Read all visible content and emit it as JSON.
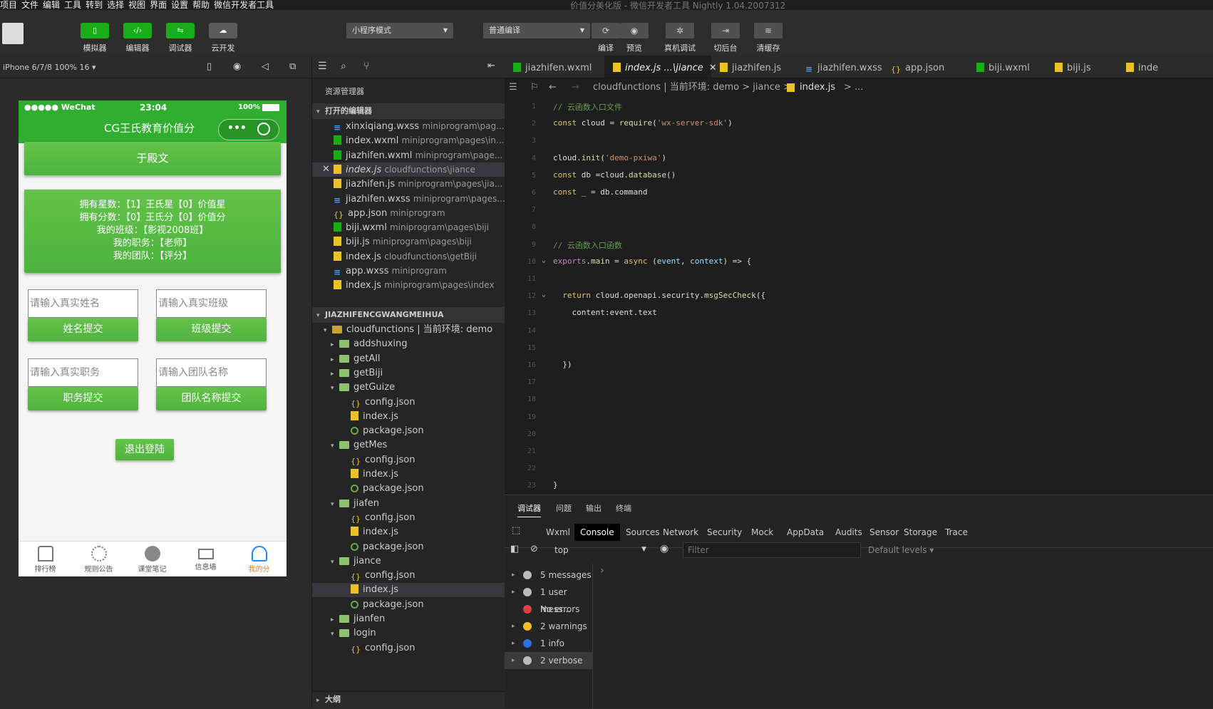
{
  "menubar": {
    "items": [
      "项目",
      "文件",
      "编辑",
      "工具",
      "转到",
      "选择",
      "视图",
      "界面",
      "设置",
      "帮助",
      "微信开发者工具"
    ],
    "window_title": "价值分美化版 - 微信开发者工具 Nightly 1.04.2007312"
  },
  "toolbar": {
    "simulator": "模拟器",
    "editor": "编辑器",
    "debugger": "调试器",
    "cloud": "云开发",
    "mode_select": "小程序模式",
    "compile_select": "普通编译",
    "compile": "编译",
    "preview": "预览",
    "real_debug": "真机调试",
    "background": "切后台",
    "clear_cache": "清缓存"
  },
  "simulator": {
    "device": "iPhone 6/7/8 100% 16 ▾",
    "status_left": "●●●●● WeChat",
    "status_time": "23:04",
    "status_battery": "100%",
    "nav_title": "CG王氏教育价值分",
    "user_name": "于殿文",
    "info_lines": [
      "拥有星数：【1】王氏星【0】价值星",
      "拥有分数：【0】王氏分【0】价值分",
      "我的班级：【影视2008班】",
      "我的职务：【老师】",
      "我的团队：【评分】"
    ],
    "name_placeholder": "请输入真实姓名",
    "class_placeholder": "请输入真实班级",
    "name_submit": "姓名提交",
    "class_submit": "班级提交",
    "duty_placeholder": "请输入真实职务",
    "team_placeholder": "请输入团队名称",
    "duty_submit": "职务提交",
    "team_submit": "团队名称提交",
    "logout": "退出登陆",
    "tabs": [
      "排行榜",
      "规则公告",
      "课堂笔记",
      "信息墙",
      "我的分"
    ],
    "active_tab_color": "#1a8cff"
  },
  "explorer": {
    "header": "资源管理器",
    "open_editors_title": "打开的编辑器",
    "open_editors": [
      {
        "name": "xinxiqiang.wxss",
        "path": "miniprogram\\pag...",
        "type": "css"
      },
      {
        "name": "index.wxml",
        "path": "miniprogram\\pages\\in...",
        "type": "wxml"
      },
      {
        "name": "jiazhifen.wxml",
        "path": "miniprogram\\page...",
        "type": "wxml"
      },
      {
        "name": "index.js",
        "path": "cloudfunctions\\jiance",
        "type": "js"
      },
      {
        "name": "jiazhifen.js",
        "path": "miniprogram\\pages\\jia...",
        "type": "js"
      },
      {
        "name": "jiazhifen.wxss",
        "path": "miniprogram\\pages...",
        "type": "css"
      },
      {
        "name": "app.json",
        "path": "miniprogram",
        "type": "json"
      },
      {
        "name": "biji.wxml",
        "path": "miniprogram\\pages\\biji",
        "type": "wxml"
      },
      {
        "name": "biji.js",
        "path": "miniprogram\\pages\\biji",
        "type": "js"
      },
      {
        "name": "index.js",
        "path": "cloudfunctions\\getBiji",
        "type": "js"
      },
      {
        "name": "app.wxss",
        "path": "miniprogram",
        "type": "css"
      },
      {
        "name": "index.js",
        "path": "miniprogram\\pages\\index",
        "type": "js"
      }
    ],
    "project_title": "JIAZHIFENCGWANGMEIHUA",
    "tree": [
      {
        "name": "cloudfunctions | 当前环境: demo",
        "type": "opendir",
        "indent": 1,
        "caret": "▾"
      },
      {
        "name": "addshuxing",
        "type": "dir",
        "indent": 2,
        "caret": "▸"
      },
      {
        "name": "getAll",
        "type": "dir",
        "indent": 2,
        "caret": "▸"
      },
      {
        "name": "getBiji",
        "type": "dir",
        "indent": 2,
        "caret": "▸"
      },
      {
        "name": "getGuize",
        "type": "dir",
        "indent": 2,
        "caret": "▾"
      },
      {
        "name": "config.json",
        "type": "json",
        "indent": 3,
        "caret": ""
      },
      {
        "name": "index.js",
        "type": "js",
        "indent": 3,
        "caret": ""
      },
      {
        "name": "package.json",
        "type": "pkg",
        "indent": 3,
        "caret": ""
      },
      {
        "name": "getMes",
        "type": "dir",
        "indent": 2,
        "caret": "▾"
      },
      {
        "name": "config.json",
        "type": "json",
        "indent": 3,
        "caret": ""
      },
      {
        "name": "index.js",
        "type": "js",
        "indent": 3,
        "caret": ""
      },
      {
        "name": "package.json",
        "type": "pkg",
        "indent": 3,
        "caret": ""
      },
      {
        "name": "jiafen",
        "type": "dir",
        "indent": 2,
        "caret": "▾"
      },
      {
        "name": "config.json",
        "type": "json",
        "indent": 3,
        "caret": ""
      },
      {
        "name": "index.js",
        "type": "js",
        "indent": 3,
        "caret": ""
      },
      {
        "name": "package.json",
        "type": "pkg",
        "indent": 3,
        "caret": ""
      },
      {
        "name": "jiance",
        "type": "dir",
        "indent": 2,
        "caret": "▾"
      },
      {
        "name": "config.json",
        "type": "json",
        "indent": 3,
        "caret": ""
      },
      {
        "name": "index.js",
        "type": "js",
        "indent": 3,
        "caret": "",
        "selected": true
      },
      {
        "name": "package.json",
        "type": "pkg",
        "indent": 3,
        "caret": ""
      },
      {
        "name": "jianfen",
        "type": "dir",
        "indent": 2,
        "caret": "▸"
      },
      {
        "name": "login",
        "type": "dir",
        "indent": 2,
        "caret": "▾"
      },
      {
        "name": "config.json",
        "type": "json",
        "indent": 3,
        "caret": ""
      }
    ],
    "outline_title": "大纲"
  },
  "editor_tabs": [
    {
      "name": "jiazhifen.wxml",
      "type": "wxml"
    },
    {
      "name": "index.js ...\\jiance",
      "type": "js",
      "active": true
    },
    {
      "name": "jiazhifen.js",
      "type": "js"
    },
    {
      "name": "jiazhifen.wxss",
      "type": "css"
    },
    {
      "name": "app.json",
      "type": "json"
    },
    {
      "name": "biji.wxml",
      "type": "wxml"
    },
    {
      "name": "biji.js",
      "type": "js"
    },
    {
      "name": "inde",
      "type": "js"
    }
  ],
  "breadcrumb": {
    "path": "cloudfunctions | 当前环境: demo  >  jiance  >",
    "file": "index.js",
    "more": "> ..."
  },
  "code_lines": [
    "// 云函数入口文件",
    "const cloud = require('wx-server-sdk')",
    "",
    "cloud.init('demo-pxiwa')",
    "const db =cloud.database()",
    "const _ = db.command",
    "",
    "",
    "// 云函数入口函数",
    "exports.main = async (event, context) => {",
    "",
    "  return cloud.openapi.security.msgSecCheck({",
    "    content:event.text",
    "",
    "",
    "  })",
    "",
    "",
    "",
    "",
    "",
    "",
    "}"
  ],
  "devtools": {
    "top_tabs": [
      "调试器",
      "问题",
      "输出",
      "终端"
    ],
    "panels": [
      "Wxml",
      "Console",
      "Sources",
      "Network",
      "Security",
      "Mock",
      "AppData",
      "Audits",
      "Sensor",
      "Storage",
      "Trace"
    ],
    "active_panel": "Console",
    "context": "top",
    "filter_placeholder": "Filter",
    "levels": "Default levels ▾",
    "messages": [
      {
        "label": "5 messages",
        "icon": "list-icon",
        "color": "#bbbbbb"
      },
      {
        "label": "1 user mess...",
        "icon": "user-icon",
        "color": "#bbbbbb"
      },
      {
        "label": "No errors",
        "icon": "error-icon",
        "color": "#e04040"
      },
      {
        "label": "2 warnings",
        "icon": "warning-icon",
        "color": "#f0c020"
      },
      {
        "label": "1 info",
        "icon": "info-icon",
        "color": "#2f6fe0"
      },
      {
        "label": "2 verbose",
        "icon": "gear-icon",
        "color": "#bbbbbb"
      }
    ],
    "prompt": "›"
  }
}
